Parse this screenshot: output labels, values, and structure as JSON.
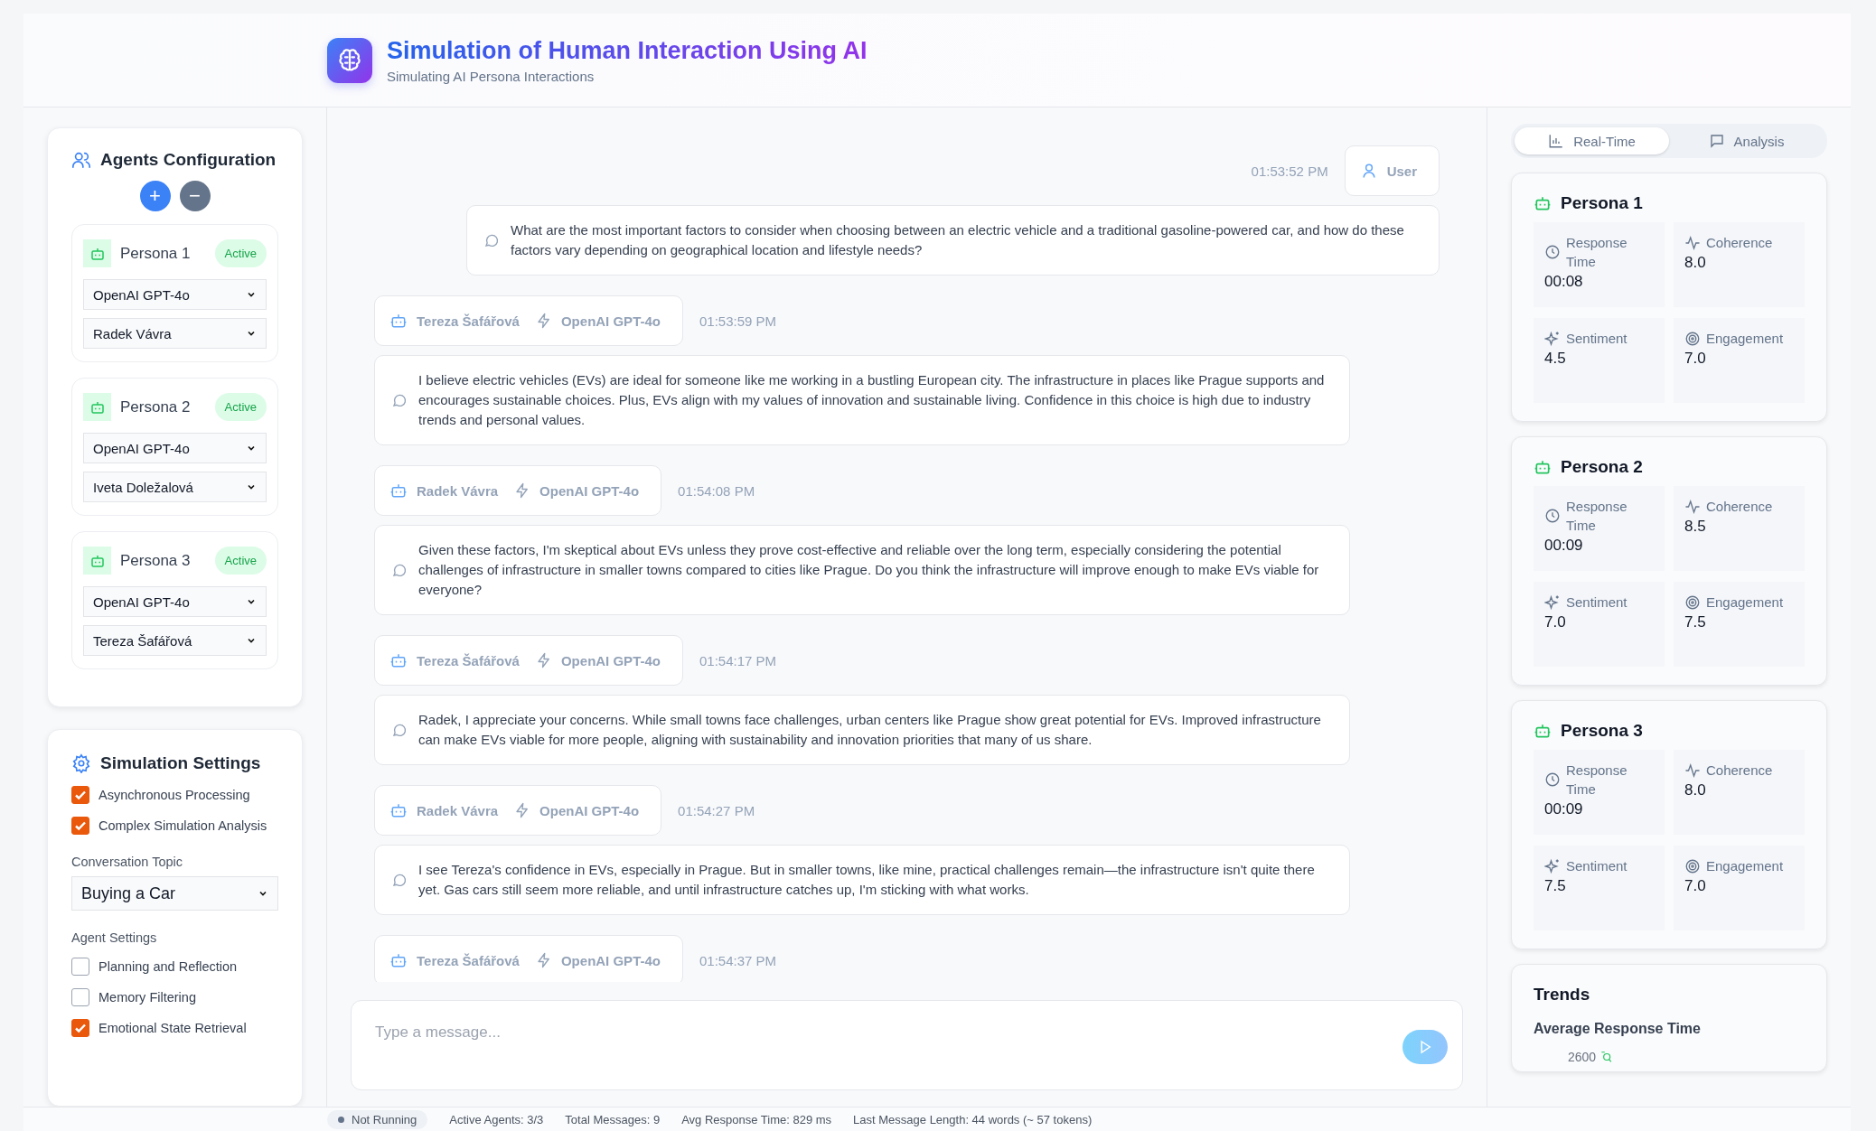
{
  "header": {
    "title": "Simulation of Human Interaction Using AI",
    "subtitle": "Simulating AI Persona Interactions"
  },
  "agents": {
    "title": "Agents Configuration",
    "add": "+",
    "remove": "−",
    "personas": [
      {
        "name": "Persona 1",
        "status": "Active",
        "model": "OpenAI GPT-4o",
        "character": "Radek Vávra"
      },
      {
        "name": "Persona 2",
        "status": "Active",
        "model": "OpenAI GPT-4o",
        "character": "Iveta Doležalová"
      },
      {
        "name": "Persona 3",
        "status": "Active",
        "model": "OpenAI GPT-4o",
        "character": "Tereza Šafářová"
      }
    ]
  },
  "settings": {
    "title": "Simulation Settings",
    "options": [
      {
        "label": "Asynchronous Processing",
        "checked": true
      },
      {
        "label": "Complex Simulation Analysis",
        "checked": true
      }
    ],
    "topic_label": "Conversation Topic",
    "topic": "Buying a Car",
    "agent_settings_label": "Agent Settings",
    "agent_options": [
      {
        "label": "Planning and Reflection",
        "checked": false
      },
      {
        "label": "Memory Filtering",
        "checked": false
      },
      {
        "label": "Emotional State Retrieval",
        "checked": true
      }
    ]
  },
  "messages": [
    {
      "kind": "user",
      "author": "User",
      "time": "01:53:52 PM",
      "text": "What are the most important factors to consider when choosing between an electric vehicle and a traditional gasoline-powered car, and how do these factors vary depending on geographical location and lifestyle needs?"
    },
    {
      "kind": "agent",
      "author": "Tereza Šafářová",
      "model": "OpenAI GPT-4o",
      "time": "01:53:59 PM",
      "text": "I believe electric vehicles (EVs) are ideal for someone like me working in a bustling European city. The infrastructure in places like Prague supports and encourages sustainable choices. Plus, EVs align with my values of innovation and sustainable living. Confidence in this choice is high due to industry trends and personal values."
    },
    {
      "kind": "agent",
      "author": "Radek Vávra",
      "model": "OpenAI GPT-4o",
      "time": "01:54:08 PM",
      "text": "Given these factors, I'm skeptical about EVs unless they prove cost-effective and reliable over the long term, especially considering the potential challenges of infrastructure in smaller towns compared to cities like Prague. Do you think the infrastructure will improve enough to make EVs viable for everyone?"
    },
    {
      "kind": "agent",
      "author": "Tereza Šafářová",
      "model": "OpenAI GPT-4o",
      "time": "01:54:17 PM",
      "text": "Radek, I appreciate your concerns. While small towns face challenges, urban centers like Prague show great potential for EVs. Improved infrastructure can make EVs viable for more people, aligning with sustainability and innovation priorities that many of us share."
    },
    {
      "kind": "agent",
      "author": "Radek Vávra",
      "model": "OpenAI GPT-4o",
      "time": "01:54:27 PM",
      "text": "I see Tereza's confidence in EVs, especially in Prague. But in smaller towns, like mine, practical challenges remain—the infrastructure isn't quite there yet. Gas cars still seem more reliable, and until infrastructure catches up, I'm sticking with what works."
    },
    {
      "kind": "agent",
      "author": "Tereza Šafářová",
      "model": "OpenAI GPT-4o",
      "time": "01:54:37 PM"
    }
  ],
  "composer": {
    "placeholder": "Type a message..."
  },
  "tabs": [
    {
      "label": "Real-Time",
      "kind": "chart",
      "selected": true
    },
    {
      "label": "Analysis",
      "kind": "chat",
      "selected": false
    }
  ],
  "metrics": [
    {
      "name": "Persona 1",
      "response_label": "Response Time",
      "response": "00:08",
      "coherence_label": "Coherence",
      "coherence": "8.0",
      "sentiment_label": "Sentiment",
      "sentiment": "4.5",
      "engagement_label": "Engagement",
      "engagement": "7.0"
    },
    {
      "name": "Persona 2",
      "response_label": "Response Time",
      "response": "00:09",
      "coherence_label": "Coherence",
      "coherence": "8.5",
      "sentiment_label": "Sentiment",
      "sentiment": "7.0",
      "engagement_label": "Engagement",
      "engagement": "7.5"
    },
    {
      "name": "Persona 3",
      "response_label": "Response Time",
      "response": "00:09",
      "coherence_label": "Coherence",
      "coherence": "8.0",
      "sentiment_label": "Sentiment",
      "sentiment": "7.5",
      "engagement_label": "Engagement",
      "engagement": "7.0"
    }
  ],
  "trends": {
    "title": "Trends",
    "subtitle": "Average Response Time",
    "axis_label": "2600"
  },
  "status_bar": {
    "state": "Not Running",
    "running": false,
    "items": [
      "Active Agents: 3/3",
      "Total Messages: 9",
      "Avg Response Time: 829 ms",
      "Last Message Length: 44 words (~ 57 tokens)"
    ]
  }
}
